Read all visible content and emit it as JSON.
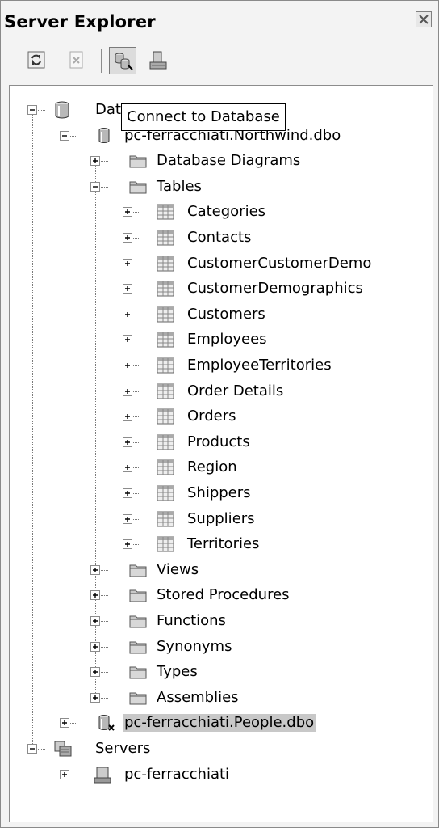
{
  "panel": {
    "title": "Server Explorer"
  },
  "toolbar": {
    "buttons": [
      {
        "name": "refresh-button",
        "icon": "refresh-icon"
      },
      {
        "name": "stop-refresh-button",
        "icon": "stop-icon"
      },
      {
        "name": "connect-to-database-button",
        "icon": "connect-database-icon"
      },
      {
        "name": "connect-to-server-button",
        "icon": "connect-server-icon"
      }
    ]
  },
  "tooltip": {
    "text": "Connect to Database"
  },
  "tree": {
    "data_connections": "Data Connections",
    "northwind": "pc-ferracchiati.Northwind.dbo",
    "database_diagrams": "Database Diagrams",
    "tables": "Tables",
    "table_items": [
      "Categories",
      "Contacts",
      "CustomerCustomerDemo",
      "CustomerDemographics",
      "Customers",
      "Employees",
      "EmployeeTerritories",
      "Order Details",
      "Orders",
      "Products",
      "Region",
      "Shippers",
      "Suppliers",
      "Territories"
    ],
    "folders_after": [
      "Views",
      "Stored Procedures",
      "Functions",
      "Synonyms",
      "Types",
      "Assemblies"
    ],
    "people": "pc-ferracchiati.People.dbo",
    "servers": "Servers",
    "server_item": "pc-ferracchiati"
  },
  "colors": {
    "selection": "#c8c8c8",
    "folder": "#c0c0c0",
    "table_grid": "#7f7f7f"
  }
}
